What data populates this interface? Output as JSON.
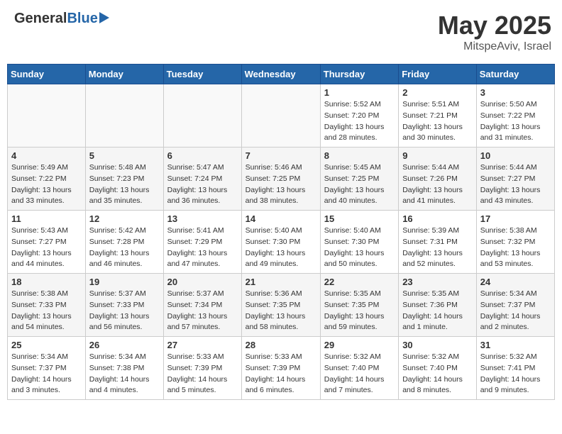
{
  "header": {
    "logo_general": "General",
    "logo_blue": "Blue",
    "title": "May 2025",
    "location": "MitspeAviv, Israel"
  },
  "days_of_week": [
    "Sunday",
    "Monday",
    "Tuesday",
    "Wednesday",
    "Thursday",
    "Friday",
    "Saturday"
  ],
  "weeks": [
    [
      {
        "day": "",
        "info": ""
      },
      {
        "day": "",
        "info": ""
      },
      {
        "day": "",
        "info": ""
      },
      {
        "day": "",
        "info": ""
      },
      {
        "day": "1",
        "info": "Sunrise: 5:52 AM\nSunset: 7:20 PM\nDaylight: 13 hours\nand 28 minutes."
      },
      {
        "day": "2",
        "info": "Sunrise: 5:51 AM\nSunset: 7:21 PM\nDaylight: 13 hours\nand 30 minutes."
      },
      {
        "day": "3",
        "info": "Sunrise: 5:50 AM\nSunset: 7:22 PM\nDaylight: 13 hours\nand 31 minutes."
      }
    ],
    [
      {
        "day": "4",
        "info": "Sunrise: 5:49 AM\nSunset: 7:22 PM\nDaylight: 13 hours\nand 33 minutes."
      },
      {
        "day": "5",
        "info": "Sunrise: 5:48 AM\nSunset: 7:23 PM\nDaylight: 13 hours\nand 35 minutes."
      },
      {
        "day": "6",
        "info": "Sunrise: 5:47 AM\nSunset: 7:24 PM\nDaylight: 13 hours\nand 36 minutes."
      },
      {
        "day": "7",
        "info": "Sunrise: 5:46 AM\nSunset: 7:25 PM\nDaylight: 13 hours\nand 38 minutes."
      },
      {
        "day": "8",
        "info": "Sunrise: 5:45 AM\nSunset: 7:25 PM\nDaylight: 13 hours\nand 40 minutes."
      },
      {
        "day": "9",
        "info": "Sunrise: 5:44 AM\nSunset: 7:26 PM\nDaylight: 13 hours\nand 41 minutes."
      },
      {
        "day": "10",
        "info": "Sunrise: 5:44 AM\nSunset: 7:27 PM\nDaylight: 13 hours\nand 43 minutes."
      }
    ],
    [
      {
        "day": "11",
        "info": "Sunrise: 5:43 AM\nSunset: 7:27 PM\nDaylight: 13 hours\nand 44 minutes."
      },
      {
        "day": "12",
        "info": "Sunrise: 5:42 AM\nSunset: 7:28 PM\nDaylight: 13 hours\nand 46 minutes."
      },
      {
        "day": "13",
        "info": "Sunrise: 5:41 AM\nSunset: 7:29 PM\nDaylight: 13 hours\nand 47 minutes."
      },
      {
        "day": "14",
        "info": "Sunrise: 5:40 AM\nSunset: 7:30 PM\nDaylight: 13 hours\nand 49 minutes."
      },
      {
        "day": "15",
        "info": "Sunrise: 5:40 AM\nSunset: 7:30 PM\nDaylight: 13 hours\nand 50 minutes."
      },
      {
        "day": "16",
        "info": "Sunrise: 5:39 AM\nSunset: 7:31 PM\nDaylight: 13 hours\nand 52 minutes."
      },
      {
        "day": "17",
        "info": "Sunrise: 5:38 AM\nSunset: 7:32 PM\nDaylight: 13 hours\nand 53 minutes."
      }
    ],
    [
      {
        "day": "18",
        "info": "Sunrise: 5:38 AM\nSunset: 7:33 PM\nDaylight: 13 hours\nand 54 minutes."
      },
      {
        "day": "19",
        "info": "Sunrise: 5:37 AM\nSunset: 7:33 PM\nDaylight: 13 hours\nand 56 minutes."
      },
      {
        "day": "20",
        "info": "Sunrise: 5:37 AM\nSunset: 7:34 PM\nDaylight: 13 hours\nand 57 minutes."
      },
      {
        "day": "21",
        "info": "Sunrise: 5:36 AM\nSunset: 7:35 PM\nDaylight: 13 hours\nand 58 minutes."
      },
      {
        "day": "22",
        "info": "Sunrise: 5:35 AM\nSunset: 7:35 PM\nDaylight: 13 hours\nand 59 minutes."
      },
      {
        "day": "23",
        "info": "Sunrise: 5:35 AM\nSunset: 7:36 PM\nDaylight: 14 hours\nand 1 minute."
      },
      {
        "day": "24",
        "info": "Sunrise: 5:34 AM\nSunset: 7:37 PM\nDaylight: 14 hours\nand 2 minutes."
      }
    ],
    [
      {
        "day": "25",
        "info": "Sunrise: 5:34 AM\nSunset: 7:37 PM\nDaylight: 14 hours\nand 3 minutes."
      },
      {
        "day": "26",
        "info": "Sunrise: 5:34 AM\nSunset: 7:38 PM\nDaylight: 14 hours\nand 4 minutes."
      },
      {
        "day": "27",
        "info": "Sunrise: 5:33 AM\nSunset: 7:39 PM\nDaylight: 14 hours\nand 5 minutes."
      },
      {
        "day": "28",
        "info": "Sunrise: 5:33 AM\nSunset: 7:39 PM\nDaylight: 14 hours\nand 6 minutes."
      },
      {
        "day": "29",
        "info": "Sunrise: 5:32 AM\nSunset: 7:40 PM\nDaylight: 14 hours\nand 7 minutes."
      },
      {
        "day": "30",
        "info": "Sunrise: 5:32 AM\nSunset: 7:40 PM\nDaylight: 14 hours\nand 8 minutes."
      },
      {
        "day": "31",
        "info": "Sunrise: 5:32 AM\nSunset: 7:41 PM\nDaylight: 14 hours\nand 9 minutes."
      }
    ]
  ]
}
